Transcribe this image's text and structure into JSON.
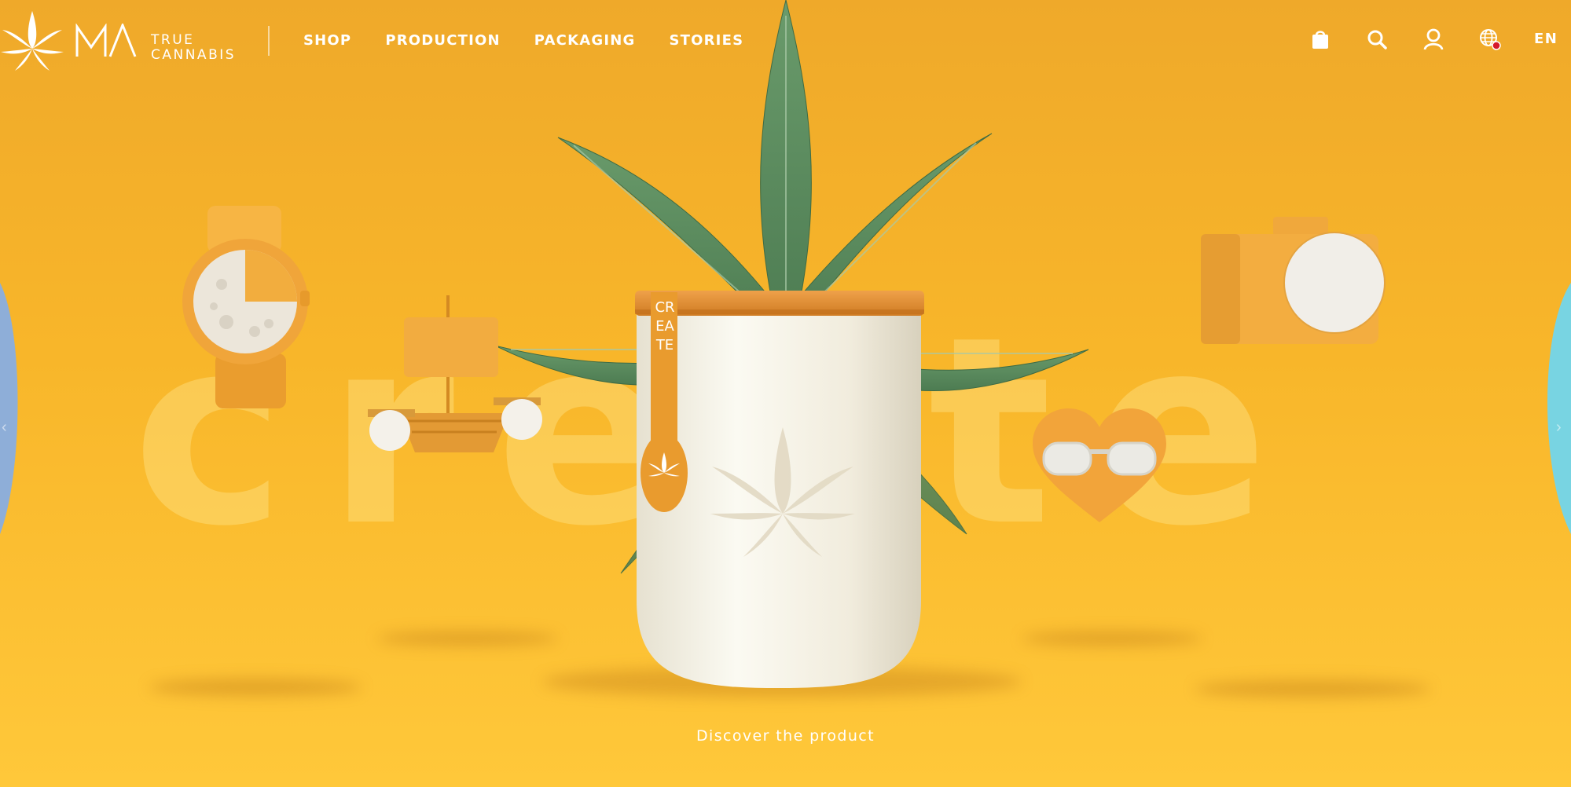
{
  "brand": {
    "monogram": "MA",
    "line1": "TRUE",
    "line2": "CANNABIS"
  },
  "nav": {
    "items": [
      {
        "label": "SHOP"
      },
      {
        "label": "PRODUCTION"
      },
      {
        "label": "PACKAGING"
      },
      {
        "label": "STORIES"
      }
    ],
    "icons": [
      "shopping-bag-icon",
      "search-icon",
      "user-icon",
      "globe-icon"
    ],
    "language": "EN",
    "globe_badge_color": "#d6192b"
  },
  "hero": {
    "background_word": "create",
    "jar_label": "CREATE",
    "cta": "Discover the product",
    "objects": [
      "watch",
      "toy-ship",
      "camera",
      "heart-sunglasses",
      "cannabis-leaf",
      "jar"
    ]
  },
  "colors": {
    "background_top": "#efa92a",
    "background_bottom": "#ffc83a",
    "leaf": "#5a8a5c",
    "jar_body": "#f6f3e7",
    "jar_lid": "#e08a28",
    "edge_left": "#8eaed8",
    "edge_right": "#78d4e2"
  }
}
